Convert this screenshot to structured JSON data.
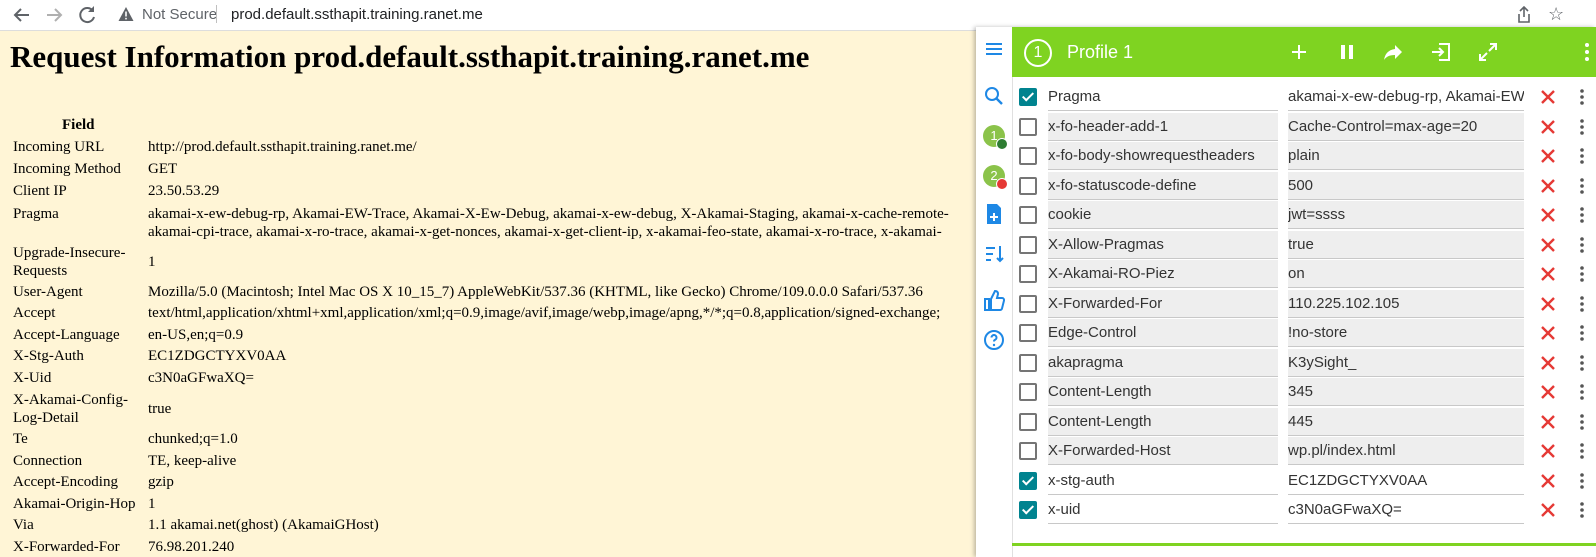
{
  "browser": {
    "security_label": "Not Secure",
    "url": "prod.default.ssthapit.training.ranet.me"
  },
  "page": {
    "title": "Request Information prod.default.ssthapit.training.ranet.me",
    "field_header": "Field",
    "rows": [
      {
        "key": "Incoming URL",
        "value": "http://prod.default.ssthapit.training.ranet.me/"
      },
      {
        "key": "Incoming Method",
        "value": "GET"
      },
      {
        "key": "Client IP",
        "value": "23.50.53.29"
      },
      {
        "key": "Pragma",
        "value": "akamai-x-ew-debug-rp, Akamai-EW-Trace, Akamai-X-Ew-Debug, akamai-x-ew-debug, X-Akamai-Staging, akamai-x-cache-remote-",
        "value2": "akamai-cpi-trace, akamai-x-ro-trace, akamai-x-get-nonces, akamai-x-get-client-ip, x-akamai-feo-state, akamai-x-ro-trace, x-akamai-"
      },
      {
        "key": "Upgrade-Insecure-",
        "key2": "Requests",
        "value": "1"
      },
      {
        "key": "User-Agent",
        "value": "Mozilla/5.0 (Macintosh; Intel Mac OS X 10_15_7) AppleWebKit/537.36 (KHTML, like Gecko) Chrome/109.0.0.0 Safari/537.36"
      },
      {
        "key": "Accept",
        "value": "text/html,application/xhtml+xml,application/xml;q=0.9,image/avif,image/webp,image/apng,*/*;q=0.8,application/signed-exchange;"
      },
      {
        "key": "Accept-Language",
        "value": "en-US,en;q=0.9"
      },
      {
        "key": "X-Stg-Auth",
        "value": "EC1ZDGCTYXV0AA"
      },
      {
        "key": "X-Uid",
        "value": "c3N0aGFwaXQ="
      },
      {
        "key": "X-Akamai-Config-",
        "key2": "Log-Detail",
        "value": "true"
      },
      {
        "key": "Te",
        "value": "chunked;q=1.0"
      },
      {
        "key": "Connection",
        "value": "TE, keep-alive"
      },
      {
        "key": "Accept-Encoding",
        "value": "gzip"
      },
      {
        "key": "Akamai-Origin-Hop",
        "value": "1"
      },
      {
        "key": "Via",
        "value": "1.1 akamai.net(ghost) (AkamaiGHost)"
      },
      {
        "key": "X-Forwarded-For",
        "value": "76.98.201.240"
      }
    ]
  },
  "extension": {
    "profile_number": "1",
    "profile_name": "Profile 1",
    "side_profiles": [
      "1",
      "2"
    ],
    "accent_color": "#7fd321",
    "headers": [
      {
        "checked": true,
        "name": "Pragma",
        "value": "akamai-x-ew-debug-rp, Akamai-EW"
      },
      {
        "checked": false,
        "name": "x-fo-header-add-1",
        "value": "Cache-Control=max-age=20"
      },
      {
        "checked": false,
        "name": "x-fo-body-showrequestheaders",
        "value": "plain"
      },
      {
        "checked": false,
        "name": "x-fo-statuscode-define",
        "value": "500"
      },
      {
        "checked": false,
        "name": "cookie",
        "value": "jwt=ssss"
      },
      {
        "checked": false,
        "name": "X-Allow-Pragmas",
        "value": "true"
      },
      {
        "checked": false,
        "name": "X-Akamai-RO-Piez",
        "value": "on"
      },
      {
        "checked": false,
        "name": "X-Forwarded-For",
        "value": "110.225.102.105"
      },
      {
        "checked": false,
        "name": "Edge-Control",
        "value": "!no-store"
      },
      {
        "checked": false,
        "name": "akapragma",
        "value": "K3ySight_"
      },
      {
        "checked": false,
        "name": "Content-Length",
        "value": "345"
      },
      {
        "checked": false,
        "name": "Content-Length",
        "value": "445"
      },
      {
        "checked": false,
        "name": "X-Forwarded-Host",
        "value": "wp.pl/index.html"
      },
      {
        "checked": true,
        "name": "x-stg-auth",
        "value": "EC1ZDGCTYXV0AA"
      },
      {
        "checked": true,
        "name": "x-uid",
        "value": "c3N0aGFwaXQ="
      }
    ]
  }
}
